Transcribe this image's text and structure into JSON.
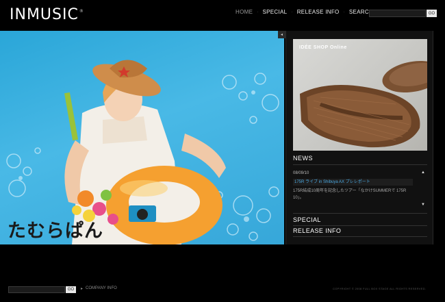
{
  "header": {
    "logo": "INMUSIC",
    "logo_mark": "®",
    "nav": [
      {
        "label": "HOME"
      },
      {
        "label": "SPECIAL"
      },
      {
        "label": "RELEASE INFO"
      },
      {
        "label": "SEARCH"
      }
    ],
    "nav_separator": "·",
    "search_placeholder": "",
    "search_go": "GO"
  },
  "hero": {
    "caption": "たむらぱん",
    "collapse_icon": "◂"
  },
  "panel": {
    "shop_title": "IDÉE SHOP Online",
    "news": {
      "heading": "NEWS",
      "date": "08/09/10",
      "headline": "175R ライブ in Shibuya AX  プレレポート",
      "body": "175R結成10周年を記念したツアー「なかけSUMMERで 175R 10」。",
      "up_icon": "▲",
      "down_icon": "▼"
    },
    "links": [
      {
        "label": "SPECIAL"
      },
      {
        "label": "RELEASE INFO"
      }
    ]
  },
  "footer": {
    "search_placeholder": "",
    "search_go": "GO",
    "bullet": "▸",
    "company_info": "COMPANY INFO",
    "copyright": "COPYRIGHT © 2008 FULL BOX STAGE ALL RIGHTS RESERVED."
  },
  "colors": {
    "background": "#000000",
    "hero_blue": "#3aaedd",
    "news_link": "#4aa8e0"
  }
}
